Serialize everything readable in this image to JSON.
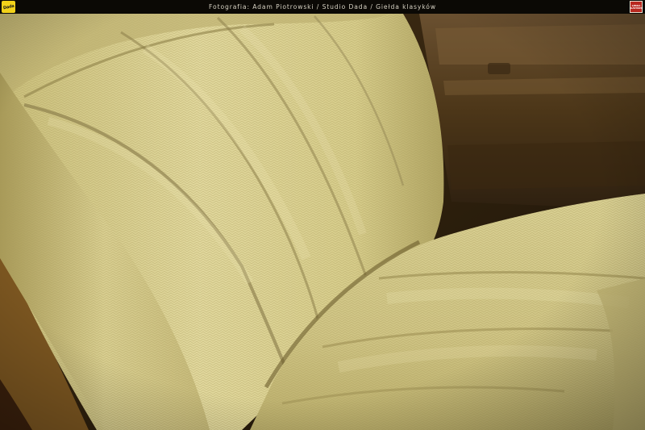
{
  "header": {
    "caption": "Fotografia: Adam Piotrowski / Studio Dada / Giełda klasyków",
    "left_logo_text": "Dada",
    "right_logo_text_1": "GIEŁDA",
    "right_logo_text_2": "KLASYKÓW"
  },
  "photo": {
    "subject": "car-seat-herringbone-upholstery",
    "colors": {
      "fabric": "#d3c98a",
      "fabric_shadow": "#8f8148",
      "interior_dark": "#3a2a14",
      "door_panel": "#5a4220"
    }
  }
}
